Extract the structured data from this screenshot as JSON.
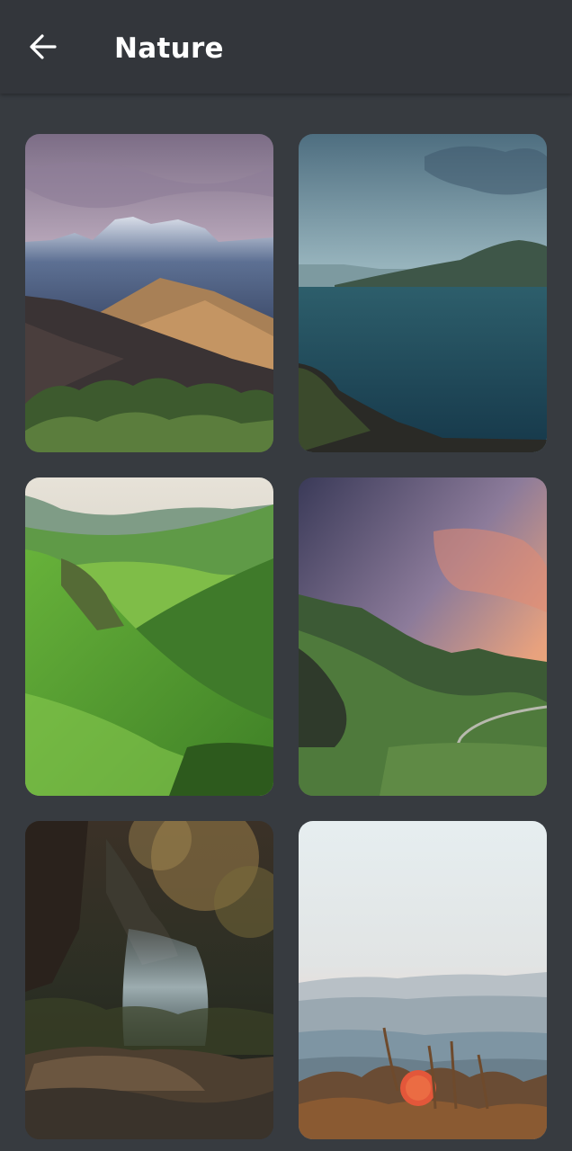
{
  "header": {
    "back_icon": "arrow-left-icon",
    "title": "Nature"
  },
  "colors": {
    "background": "#373b40",
    "app_bar": "#33363b",
    "title_text": "#ffffff"
  },
  "gallery": {
    "images": [
      {
        "subject": "snowy-mountain-range"
      },
      {
        "subject": "mountain-lake"
      },
      {
        "subject": "green-valley"
      },
      {
        "subject": "sunset-hills-road"
      },
      {
        "subject": "forest-waterfall"
      },
      {
        "subject": "misty-hills-sunrise"
      }
    ]
  }
}
